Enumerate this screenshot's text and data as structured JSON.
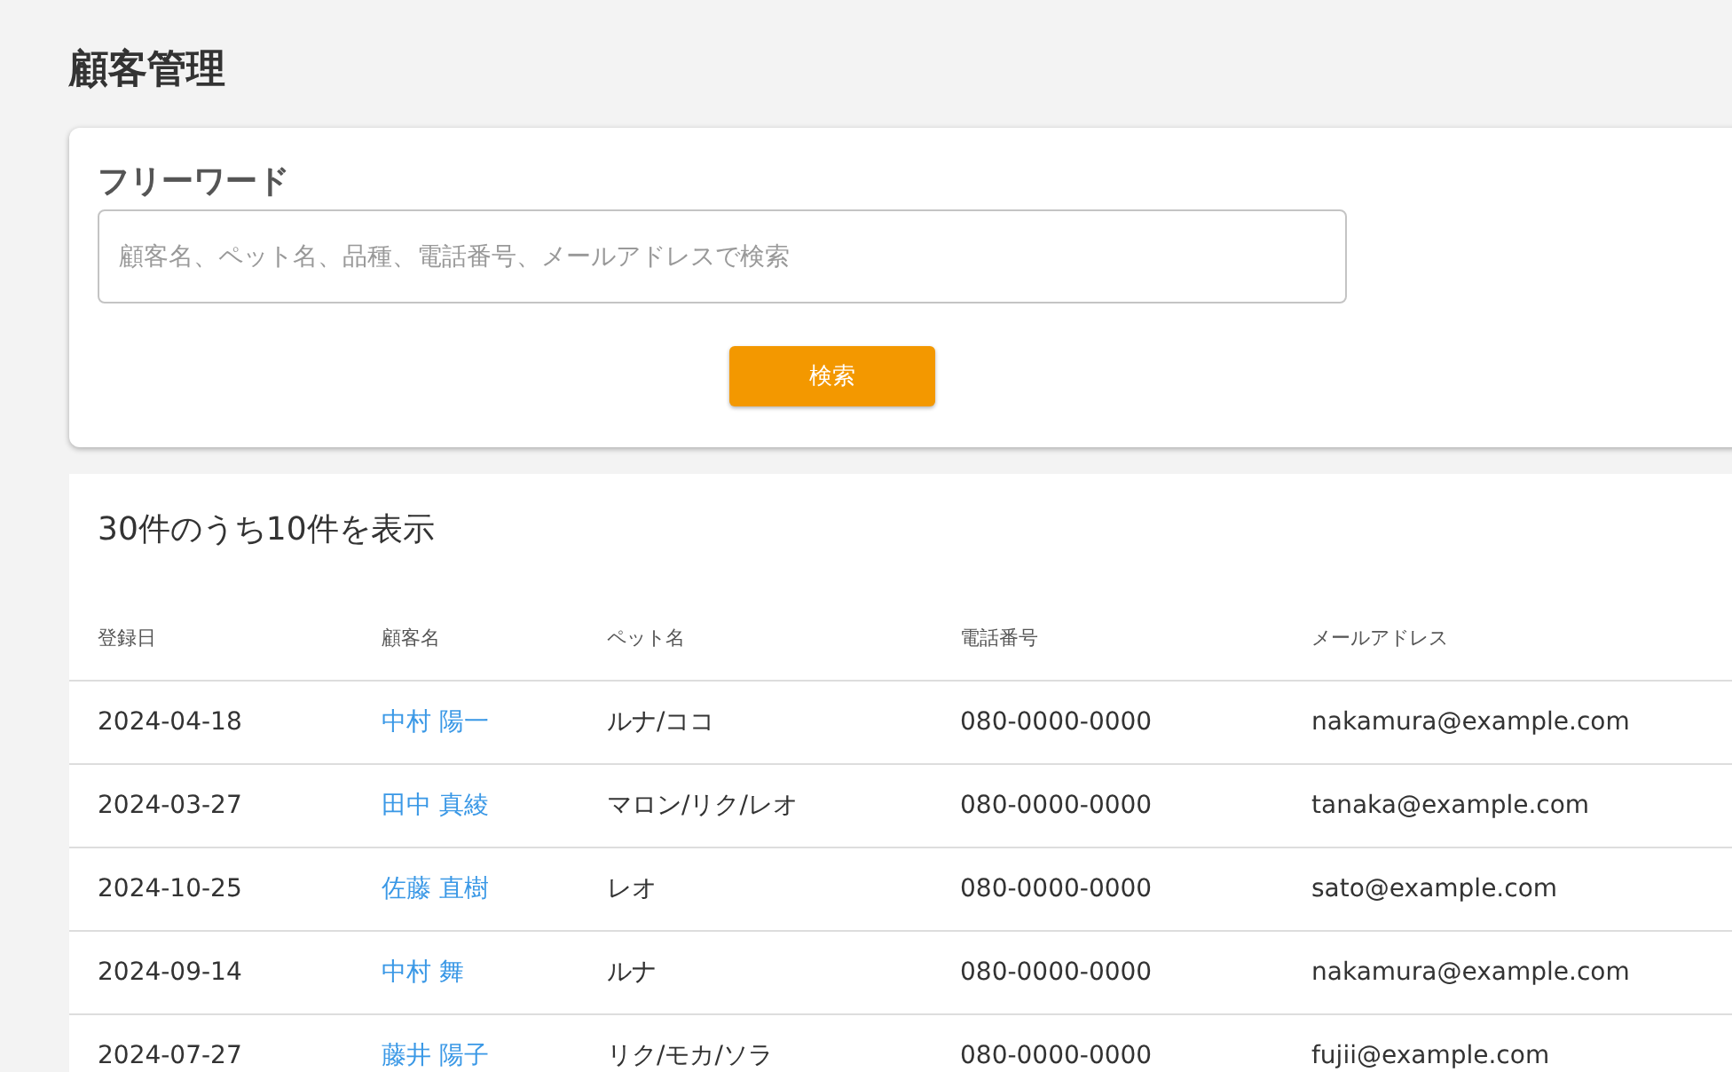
{
  "page_title": "顧客管理",
  "search": {
    "label": "フリーワード",
    "placeholder": "顧客名、ペット名、品種、電話番号、メールアドレスで検索",
    "button": "検索"
  },
  "results": {
    "count_text": "30件のうち10件を表示",
    "columns": [
      "登録日",
      "顧客名",
      "ペット名",
      "電話番号",
      "メールアドレス"
    ],
    "rows": [
      {
        "date": "2024-04-18",
        "customer": "中村 陽一",
        "pets": "ルナ/ココ",
        "phone": "080-0000-0000",
        "email": "nakamura@example.com"
      },
      {
        "date": "2024-03-27",
        "customer": "田中 真綾",
        "pets": "マロン/リク/レオ",
        "phone": "080-0000-0000",
        "email": "tanaka@example.com"
      },
      {
        "date": "2024-10-25",
        "customer": "佐藤 直樹",
        "pets": "レオ",
        "phone": "080-0000-0000",
        "email": "sato@example.com"
      },
      {
        "date": "2024-09-14",
        "customer": "中村 舞",
        "pets": "ルナ",
        "phone": "080-0000-0000",
        "email": "nakamura@example.com"
      },
      {
        "date": "2024-07-27",
        "customer": "藤井 陽子",
        "pets": "リク/モカ/ソラ",
        "phone": "080-0000-0000",
        "email": "fujii@example.com"
      }
    ]
  }
}
